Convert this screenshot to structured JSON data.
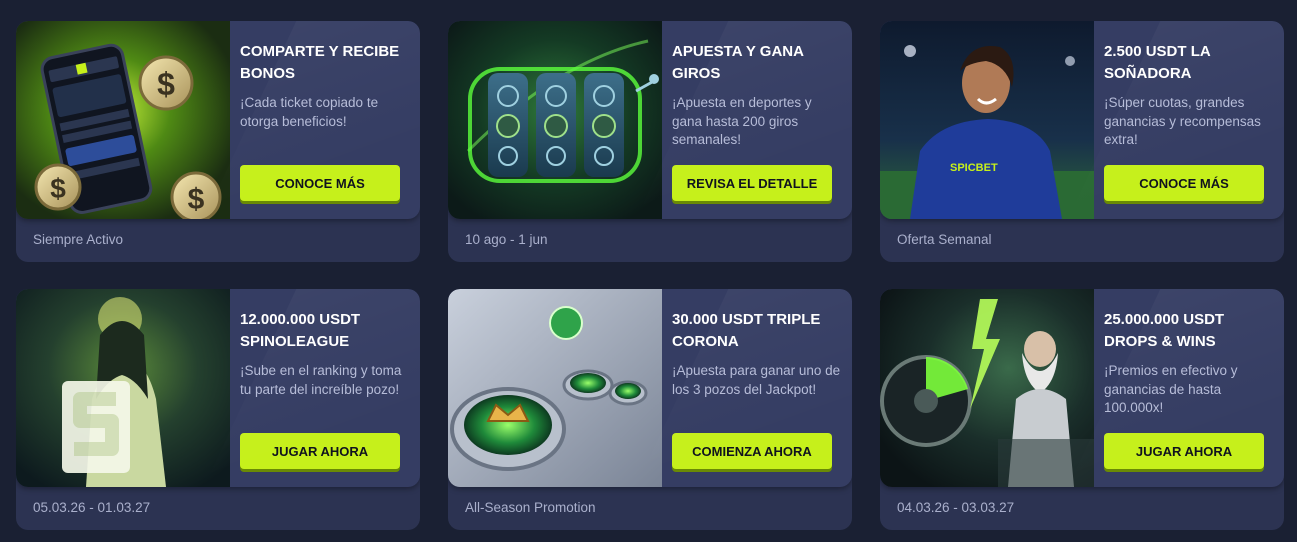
{
  "promotions": [
    {
      "title": "COMPARTE Y RECIBE BONOS",
      "description": "¡Cada ticket copiado te otorga beneficios!",
      "cta": "CONOCE MÁS",
      "footer": "Siempre Activo",
      "art": "phone-with-coins"
    },
    {
      "title": "APUESTA Y GANA GIROS",
      "description": "¡Apuesta en deportes y gana hasta 200 giros semanales!",
      "cta": "REVISA EL DETALLE",
      "footer": "10 ago - 1 jun",
      "art": "slot-reels"
    },
    {
      "title": "2.500 USDT LA SOÑADORA",
      "description": "¡Súper cuotas, grandes ganancias y recompensas extra!",
      "cta": "CONOCE MÁS",
      "footer": "Oferta Semanal",
      "art": "soccer-player",
      "art_text": "SPICBET"
    },
    {
      "title": "12.000.000 USDT SPINOLEAGUE",
      "description": "¡Sube en el ranking y toma tu parte del increíble pozo!",
      "cta": "JUGAR AHORA",
      "footer": "05.03.26 - 01.03.27",
      "art": "goddess-with-s-logo"
    },
    {
      "title": "30.000 USDT TRIPLE CORONA",
      "description": "¡Apuesta para ganar uno de los 3 pozos del Jackpot!",
      "cta": "COMIENZA AHORA",
      "footer": "All-Season Promotion",
      "art": "crown-portals"
    },
    {
      "title": "25.000.000 USDT DROPS & WINS",
      "description": "¡Premios en efectivo y ganancias de hasta 100.000x!",
      "cta": "JUGAR AHORA",
      "footer": "04.03.26 - 03.03.27",
      "art": "zeus-with-lightning"
    }
  ],
  "colors": {
    "page_background": "#1a2033",
    "card_background": "#2c3352",
    "card_top": "#353d63",
    "accent": "#c6f01b",
    "title_text": "#ffffff",
    "body_text": "#b6bcd8"
  }
}
